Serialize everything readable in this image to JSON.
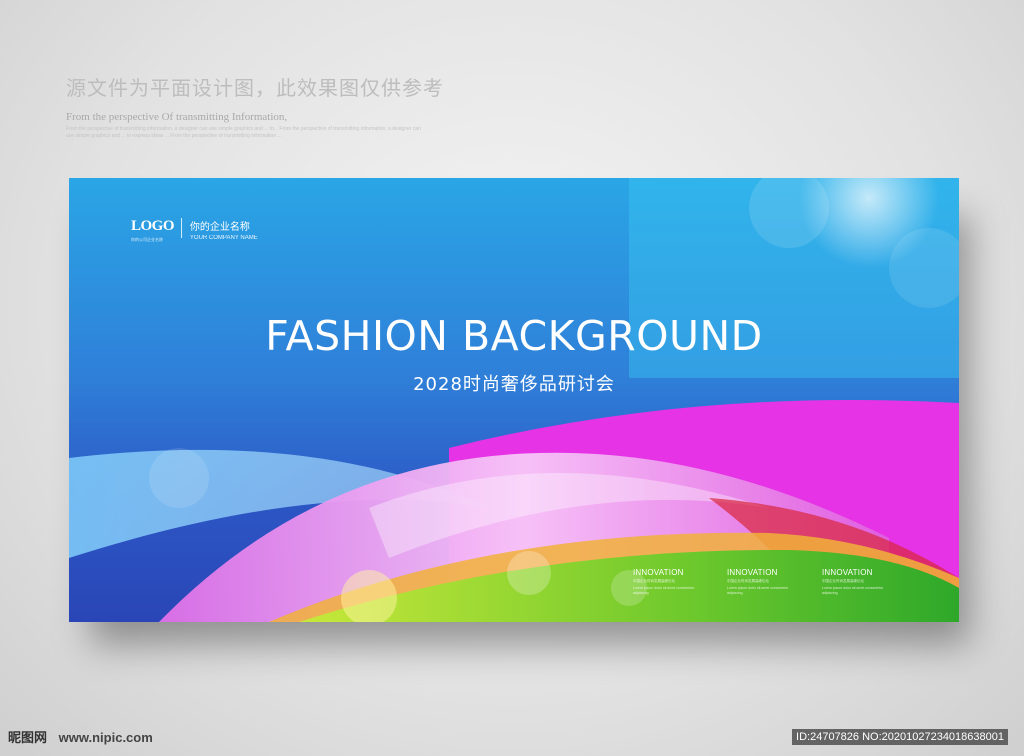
{
  "header": {
    "cn": "源文件为平面设计图，此效果图仅供参考",
    "en": "From the perspective Of transmitting Information,",
    "small_text": "From the perspective of transmitting information, a designer can use simple graphics and ... to... From the perspective of transmitting information, a designer can use simple graphics and ... to express ideas ... From the perspective of transmitting information ..."
  },
  "banner": {
    "logo": {
      "mark": "LOGO",
      "mark_sub": "你的公司企业名称",
      "name": "你的企业名称",
      "en": "YOUR COMPANY NAME"
    },
    "title": "FASHION BACKGROUND",
    "subtitle": "2028时尚奢侈品研讨会",
    "innovations": [
      {
        "title": "INNOVATION",
        "line1": "中国企业时尚发展高峰论坛",
        "line2": "Lorem ipsum dolor sit amet consectetur adipiscing"
      },
      {
        "title": "INNOVATION",
        "line1": "中国企业时尚发展高峰论坛",
        "line2": "Lorem ipsum dolor sit amet consectetur adipiscing"
      },
      {
        "title": "INNOVATION",
        "line1": "中国企业时尚发展高峰论坛",
        "line2": "Lorem ipsum dolor sit amet consectetur adipiscing"
      }
    ]
  },
  "watermark": {
    "logo": "昵图网",
    "url": "www.nipic.com",
    "id": "ID:24707826 NO:20201027234018638001"
  }
}
